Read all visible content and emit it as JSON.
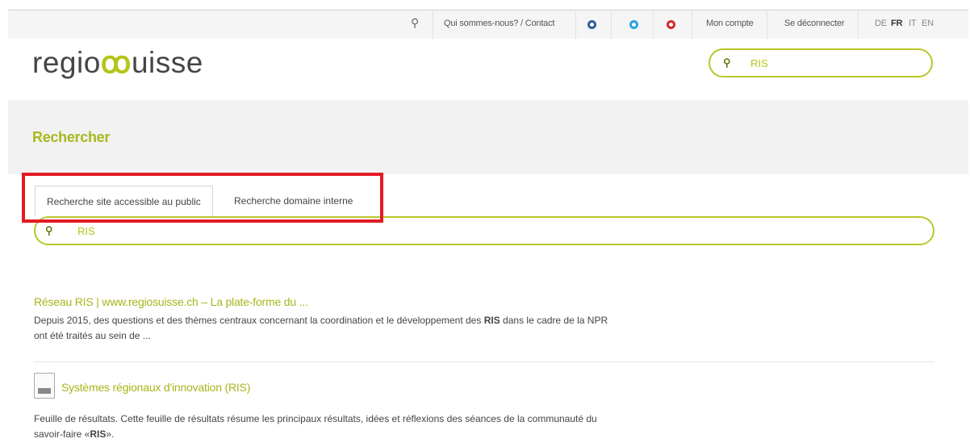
{
  "topbar": {
    "search_icon": "search-icon",
    "about_contact": "Qui sommes-nous? / Contact",
    "social": [
      {
        "name": "linkedin-icon",
        "color": "#2c5f97"
      },
      {
        "name": "twitter-icon",
        "color": "#2ba3e0"
      },
      {
        "name": "youtube-icon",
        "color": "#d3282c"
      }
    ],
    "account": "Mon compte",
    "logout": "Se déconnecter",
    "languages": [
      "DE",
      "FR",
      "IT",
      "EN"
    ],
    "active_language": "FR"
  },
  "header": {
    "logo_left": "regio",
    "logo_mark": "ꝏ",
    "logo_right": "uisse",
    "search_value": "RIS"
  },
  "page": {
    "title": "Rechercher"
  },
  "tabs": [
    {
      "label": "Recherche site accessible au public",
      "active": true
    },
    {
      "label": "Recherche domaine interne",
      "active": false
    }
  ],
  "main_search": {
    "value": "RIS"
  },
  "results": [
    {
      "title": "Réseau RIS | www.regiosuisse.ch – La plate-forme du ...",
      "snippet_before": "Depuis 2015, des questions et des thèmes centraux concernant la coordination et le développement des ",
      "snippet_bold": "RIS",
      "snippet_after": " dans le cadre de la NPR ont été traités au sein de ...",
      "icon": ""
    },
    {
      "title": "Systèmes régionaux d'innovation (RIS)",
      "snippet_before": "Feuille de résultats. Cette feuille de résultats résume les principaux résultats, idées et réflexions des séances de la communauté du savoir-faire «",
      "snippet_bold": "RIS",
      "snippet_after": "».",
      "icon": "pdf-icon"
    }
  ],
  "colors": {
    "accent": "#b5c51b",
    "highlight": "#e31b23"
  }
}
